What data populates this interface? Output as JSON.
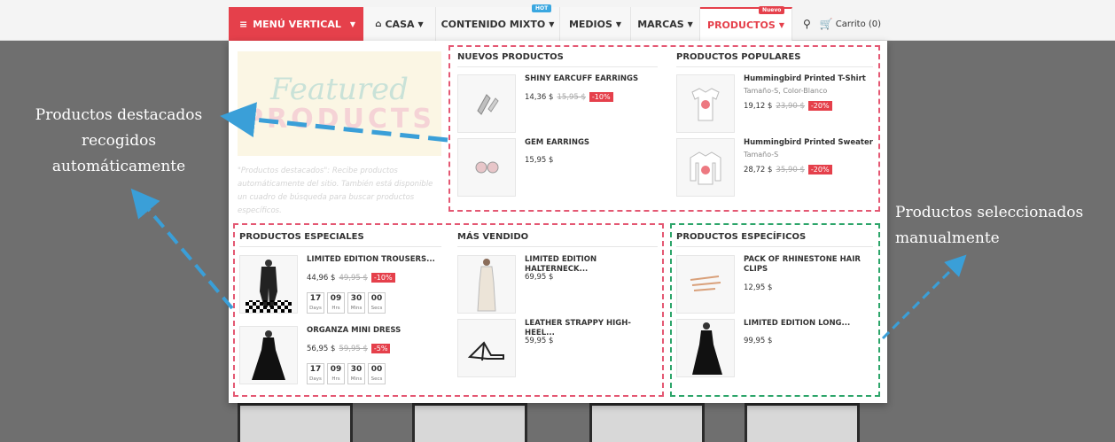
{
  "nav": {
    "vertical_menu": "MENÚ VERTICAL",
    "items": [
      {
        "label": "CASA"
      },
      {
        "label": "CONTENIDO MIXTO",
        "badge": "HOT"
      },
      {
        "label": "MEDIOS"
      },
      {
        "label": "MARCAS"
      },
      {
        "label": "PRODUCTOS",
        "badge": "Nuevo"
      }
    ],
    "cart": "Carrito (0)"
  },
  "featured": {
    "script_text": "Featured",
    "block_text": "PRODUCTS",
    "description": "\"Productos destacados\": Recibe productos automáticamente del sitio. También está disponible un cuadro de búsqueda para buscar productos específicos."
  },
  "sections": {
    "new": {
      "title": "NUEVOS PRODUCTOS",
      "products": [
        {
          "name": "SHINY EARCUFF EARRINGS",
          "price": "14,36 $",
          "old_price": "15,95 $",
          "discount": "-10%"
        },
        {
          "name": "GEM EARRINGS",
          "price": "15,95 $"
        }
      ]
    },
    "popular": {
      "title": "PRODUCTOS POPULARES",
      "products": [
        {
          "name": "Hummingbird Printed T-Shirt",
          "attrs": "Tamaño-S, Color-Blanco",
          "price": "19,12 $",
          "old_price": "23,90 $",
          "discount": "-20%"
        },
        {
          "name": "Hummingbird Printed Sweater",
          "attrs": "Tamaño-S",
          "price": "28,72 $",
          "old_price": "35,90 $",
          "discount": "-20%"
        }
      ]
    },
    "special": {
      "title": "PRODUCTOS ESPECIALES",
      "products": [
        {
          "name": "LIMITED EDITION TROUSERS...",
          "price": "44,96 $",
          "old_price": "49,95 $",
          "discount": "-10%"
        },
        {
          "name": "ORGANZA MINI DRESS",
          "price": "56,95 $",
          "old_price": "59,95 $",
          "discount": "-5%"
        }
      ],
      "countdown": [
        {
          "value": "17",
          "label": "Days"
        },
        {
          "value": "09",
          "label": "Hrs"
        },
        {
          "value": "30",
          "label": "Mins"
        },
        {
          "value": "00",
          "label": "Secs"
        }
      ]
    },
    "bestseller": {
      "title": "MÁS VENDIDO",
      "products": [
        {
          "name": "LIMITED EDITION HALTERNECK...",
          "price": "69,95 $"
        },
        {
          "name": "LEATHER STRAPPY HIGH-HEEL...",
          "price": "59,95 $"
        }
      ]
    },
    "specific": {
      "title": "PRODUCTOS ESPECÍFICOS",
      "products": [
        {
          "name": "PACK OF RHINESTONE HAIR CLIPS",
          "price": "12,95 $"
        },
        {
          "name": "LIMITED EDITION LONG...",
          "price": "99,95 $"
        }
      ]
    }
  },
  "callouts": {
    "auto": [
      "Productos destacados",
      "recogidos",
      "automáticamente"
    ],
    "manual": [
      "Productos seleccionados",
      "manualmente"
    ]
  },
  "colors": {
    "accent": "#e5404b",
    "hot_badge": "#3aa7e0",
    "auto_dashes": "#e45873",
    "manual_dashes": "#2da56a",
    "arrow": "#3a9fd8"
  }
}
